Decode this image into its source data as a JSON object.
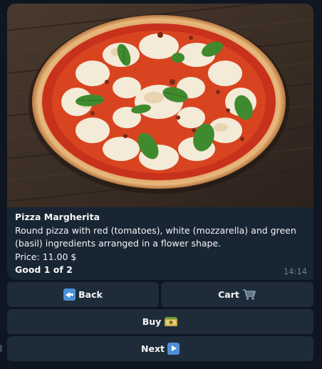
{
  "message": {
    "product_title": "Pizza Margherita",
    "description": "Round pizza with red (tomatoes), white (mozzarella) and green (basil) ingredients arranged in a flower shape.",
    "price": "Price: 11.00 $",
    "good_counter": "Good 1 of 2",
    "time": "14:14"
  },
  "keyboard": {
    "back_label": "Back",
    "cart_label": "Cart",
    "buy_label": "Buy",
    "next_label": "Next"
  },
  "icons": {
    "back": "back-arrow-icon",
    "cart": "shopping-cart-icon",
    "buy": "money-bill-icon",
    "next": "play-arrow-icon"
  },
  "colors": {
    "background": "#0e1621",
    "bubble": "#182533",
    "button": "#1e2c3a",
    "text": "#f5f5f5",
    "timestamp": "#6d7f8f"
  }
}
